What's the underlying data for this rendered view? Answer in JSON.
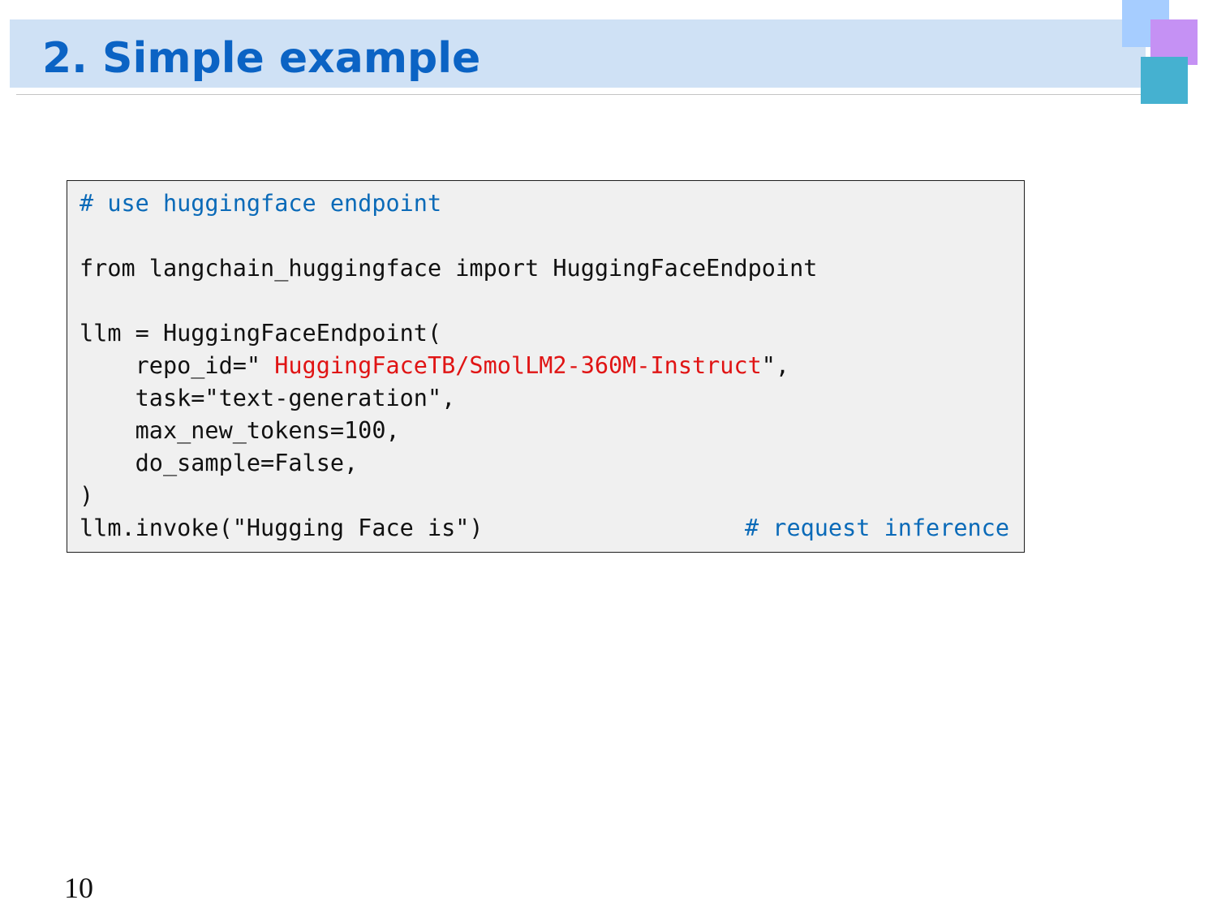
{
  "slide": {
    "title": "2. Simple example",
    "page_number": "10"
  },
  "colors": {
    "title_band": "#cfe1f5",
    "title_text": "#0b63c4",
    "code_background": "#f0f0f0",
    "comment": "#0a6ab8",
    "string_highlight": "#e01414",
    "deco_blue": "#a6cdff",
    "deco_purple": "#c591f4",
    "deco_teal": "#45b1d0"
  },
  "code": {
    "comment_endpoint": "# use huggingface endpoint",
    "import_line": "from langchain_huggingface import HuggingFaceEndpoint",
    "llm_assign": "llm = HuggingFaceEndpoint(",
    "repo_prefix": "    repo_id=\" ",
    "repo_value": "HuggingFaceTB/SmolLM2-360M-Instruct",
    "repo_suffix": "\",",
    "task_line": "    task=\"text-generation\",",
    "max_tokens_line": "    max_new_tokens=100,",
    "do_sample_line": "    do_sample=False,",
    "close_paren": ")",
    "invoke_line": "llm.invoke(\"Hugging Face is\")",
    "comment_inference": "# request inference"
  }
}
